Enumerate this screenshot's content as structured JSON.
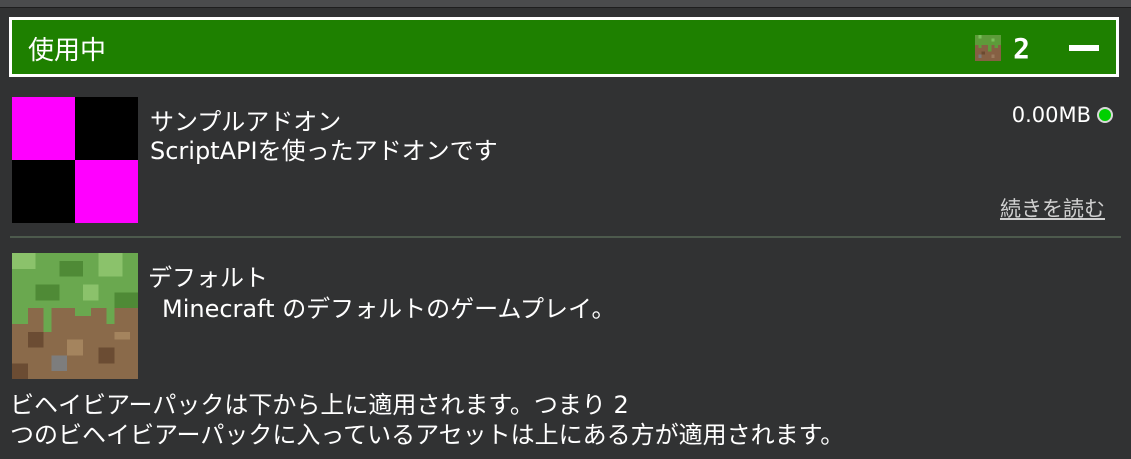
{
  "active_section": {
    "title": "使用中",
    "count": "2",
    "icons": {
      "pack_count": "grass-block-icon",
      "collapse": "minus-icon"
    }
  },
  "packs": [
    {
      "name": "サンプルアドオン",
      "description": "ScriptAPIを使ったアドオンです",
      "size": "0.00MB",
      "read_more": "続きを読む",
      "icon": "pink-black-checker-icon",
      "status_color": "#00d000"
    },
    {
      "name": "デフォルト",
      "description": "Minecraft のデフォルトのゲームプレイ。",
      "icon": "grass-block-icon"
    }
  ],
  "footer_note": {
    "line1": "ビヘイビアーパックは下から上に適用されます。つまり 2",
    "line2": "つのビヘイビアーパックに入っているアセットは上にある方が適用されます。"
  },
  "colors": {
    "header_bg": "#1e8000",
    "panel_bg": "#313233",
    "accent_magenta": "#ff00ff"
  }
}
